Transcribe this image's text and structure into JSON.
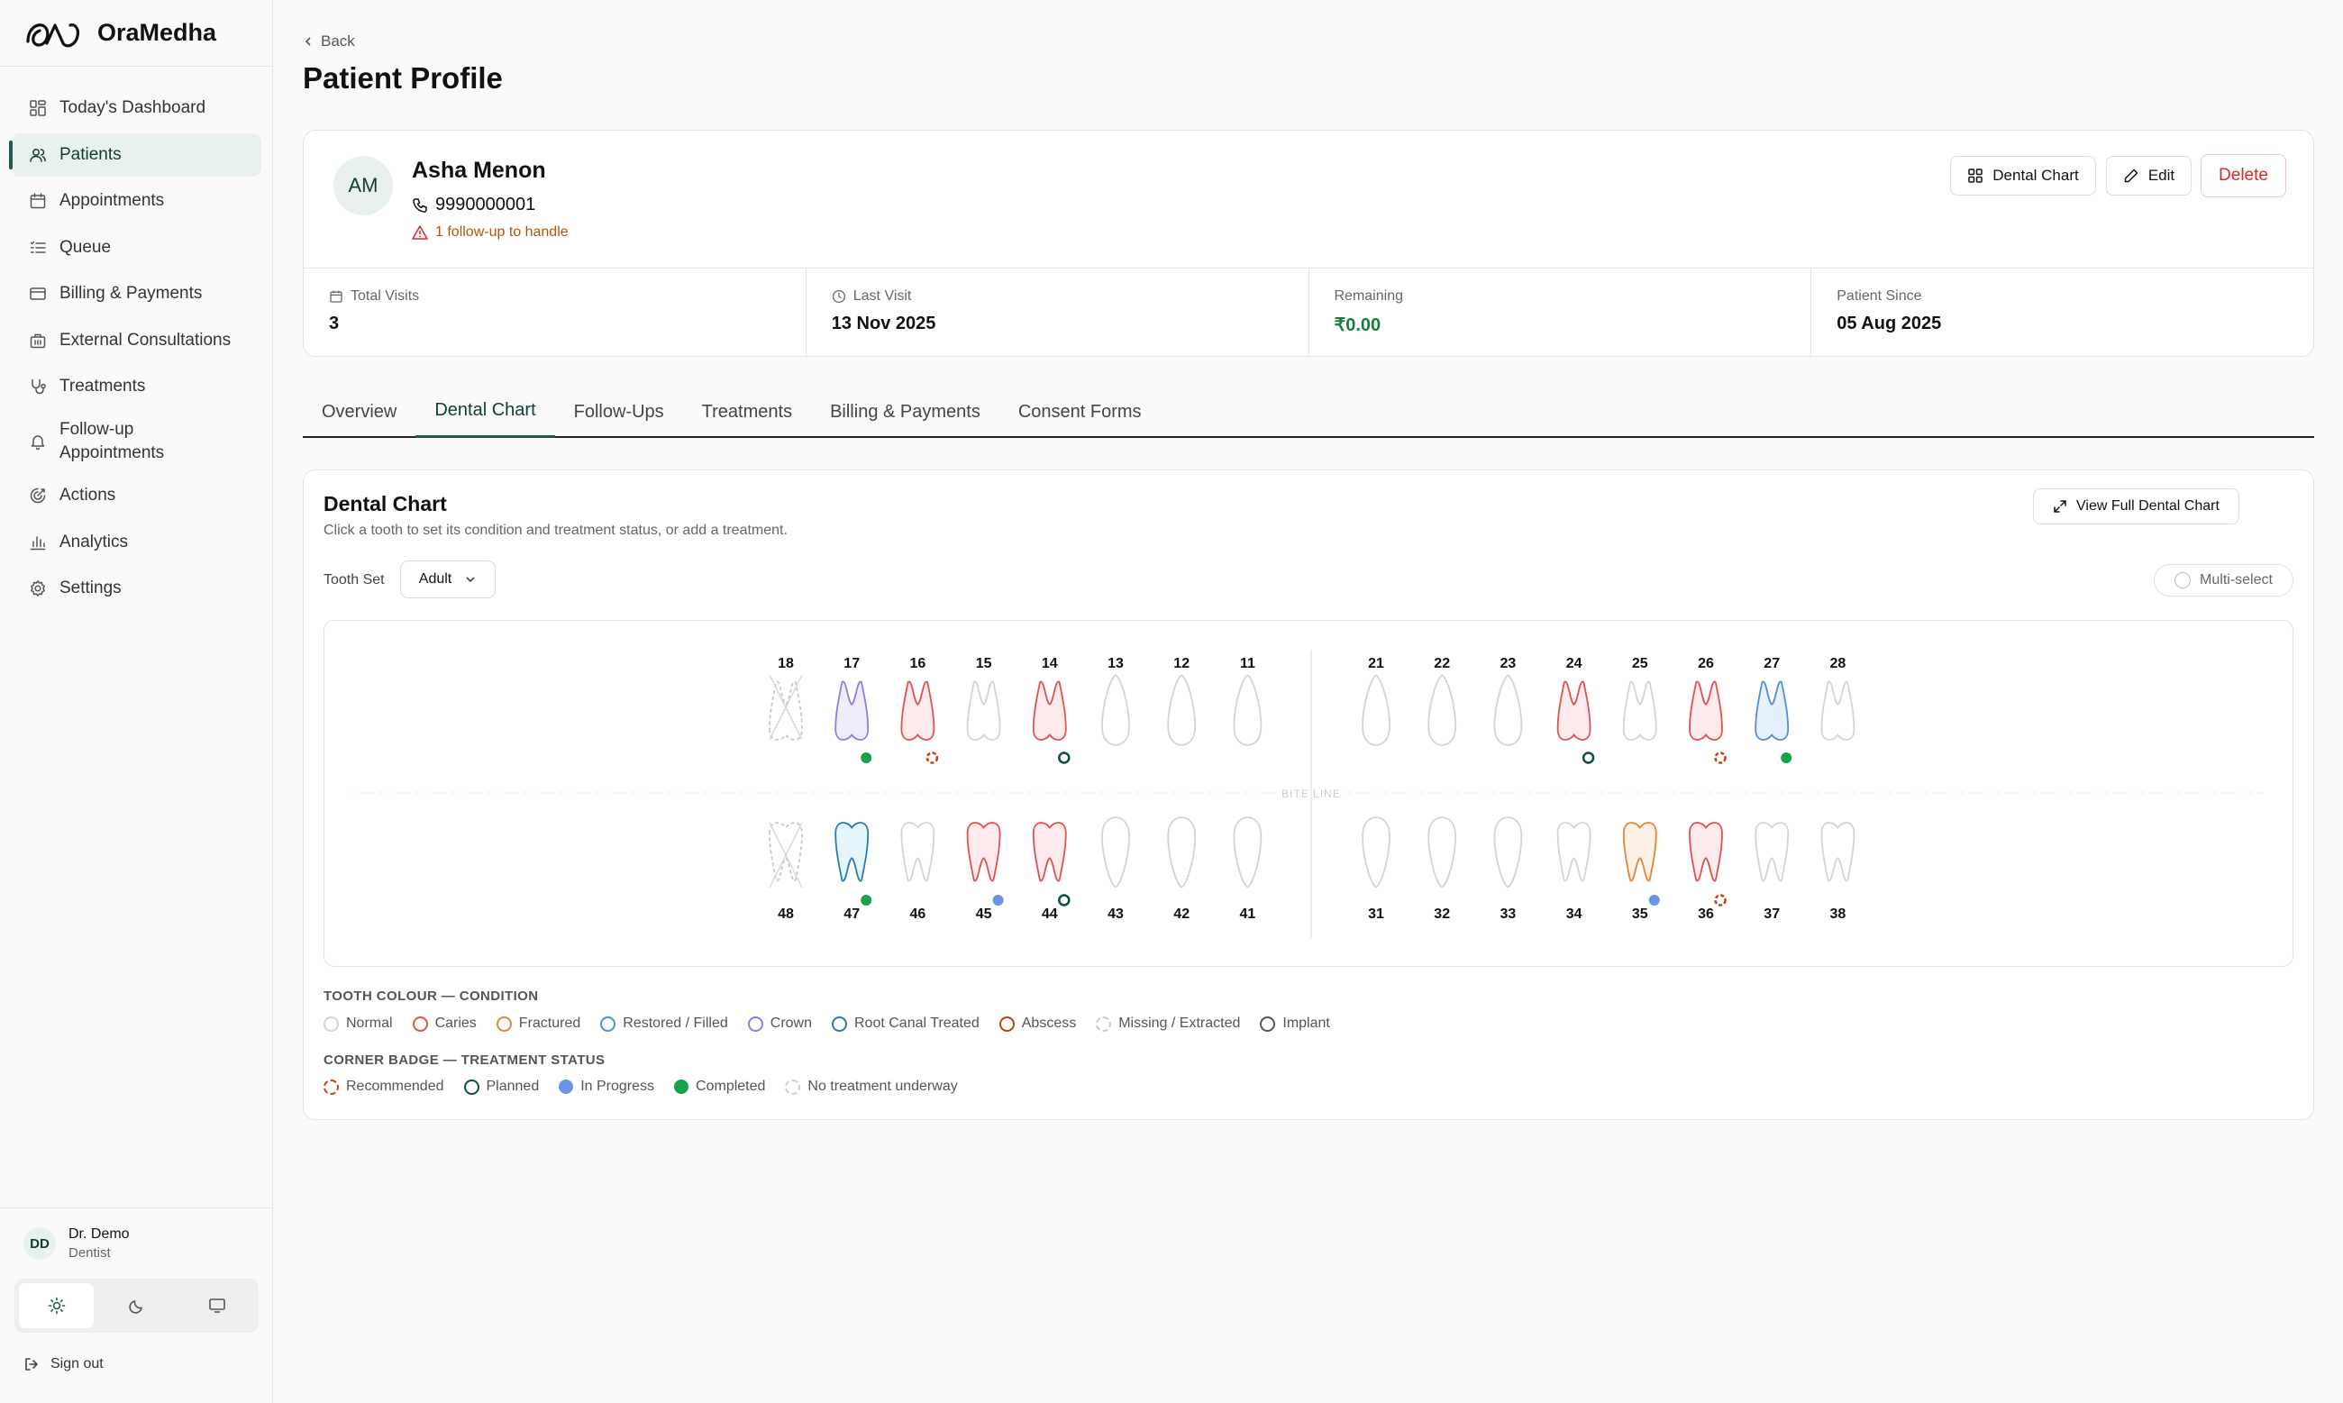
{
  "app": {
    "name": "OraMedha"
  },
  "nav": [
    {
      "id": "dashboard",
      "label": "Today's Dashboard",
      "icon": "dashboard-icon",
      "active": false
    },
    {
      "id": "patients",
      "label": "Patients",
      "icon": "users-icon",
      "active": true
    },
    {
      "id": "appointments",
      "label": "Appointments",
      "icon": "calendar-icon",
      "active": false
    },
    {
      "id": "queue",
      "label": "Queue",
      "icon": "list-icon",
      "active": false
    },
    {
      "id": "billing",
      "label": "Billing & Payments",
      "icon": "credit-card-icon",
      "active": false
    },
    {
      "id": "external",
      "label": "External Consultations",
      "icon": "building-icon",
      "active": false
    },
    {
      "id": "treatments",
      "label": "Treatments",
      "icon": "stethoscope-icon",
      "active": false
    },
    {
      "id": "followup",
      "label": "Follow-up Appointments",
      "icon": "bell-icon",
      "active": false
    },
    {
      "id": "actions",
      "label": "Actions",
      "icon": "actions-icon",
      "active": false
    },
    {
      "id": "analytics",
      "label": "Analytics",
      "icon": "bar-chart-icon",
      "active": false
    },
    {
      "id": "settings",
      "label": "Settings",
      "icon": "gear-icon",
      "active": false
    }
  ],
  "user": {
    "initials": "DD",
    "name": "Dr. Demo",
    "role": "Dentist"
  },
  "sidebar_footer": {
    "signout_label": "Sign out"
  },
  "header": {
    "back_label": "Back",
    "title": "Patient Profile"
  },
  "patient": {
    "initials": "AM",
    "name": "Asha Menon",
    "phone": "9990000001",
    "followup_warning": "1 follow-up to handle",
    "actions": {
      "dental_chart_label": "Dental Chart",
      "edit_label": "Edit",
      "delete_label": "Delete"
    },
    "stats": [
      {
        "label": "Total Visits",
        "value": "3",
        "icon": "calendar-icon"
      },
      {
        "label": "Last Visit",
        "value": "13 Nov 2025",
        "icon": "clock-icon"
      },
      {
        "label": "Remaining",
        "value": "₹0.00",
        "icon": ""
      },
      {
        "label": "Patient Since",
        "value": "05 Aug 2025",
        "icon": ""
      }
    ]
  },
  "tabs": [
    {
      "label": "Overview",
      "active": false
    },
    {
      "label": "Dental Chart",
      "active": true
    },
    {
      "label": "Follow-Ups",
      "active": false
    },
    {
      "label": "Treatments",
      "active": false
    },
    {
      "label": "Billing & Payments",
      "active": false
    },
    {
      "label": "Consent Forms",
      "active": false
    }
  ],
  "dental_chart": {
    "title": "Dental Chart",
    "subtitle": "Click a tooth to set its condition and treatment status, or add a treatment.",
    "view_full_label": "View Full Dental Chart",
    "tooth_set_label": "Tooth Set",
    "tooth_set_value": "Adult",
    "multi_select_label": "Multi-select",
    "bite_line_label": "BITE LINE",
    "upper": [
      {
        "n": "18",
        "condition": "missing",
        "status": "none"
      },
      {
        "n": "17",
        "condition": "crown",
        "status": "completed"
      },
      {
        "n": "16",
        "condition": "caries",
        "status": "recommended"
      },
      {
        "n": "15",
        "condition": "normal",
        "status": "none"
      },
      {
        "n": "14",
        "condition": "caries",
        "status": "planned"
      },
      {
        "n": "13",
        "condition": "normal",
        "status": "none"
      },
      {
        "n": "12",
        "condition": "normal",
        "status": "none"
      },
      {
        "n": "11",
        "condition": "normal",
        "status": "none"
      },
      {
        "n": "21",
        "condition": "normal",
        "status": "none"
      },
      {
        "n": "22",
        "condition": "normal",
        "status": "none"
      },
      {
        "n": "23",
        "condition": "normal",
        "status": "none"
      },
      {
        "n": "24",
        "condition": "caries",
        "status": "planned"
      },
      {
        "n": "25",
        "condition": "normal",
        "status": "none"
      },
      {
        "n": "26",
        "condition": "caries",
        "status": "recommended"
      },
      {
        "n": "27",
        "condition": "restored",
        "status": "completed"
      },
      {
        "n": "28",
        "condition": "normal",
        "status": "none"
      }
    ],
    "lower": [
      {
        "n": "48",
        "condition": "missing",
        "status": "none"
      },
      {
        "n": "47",
        "condition": "rct",
        "status": "completed"
      },
      {
        "n": "46",
        "condition": "normal",
        "status": "none"
      },
      {
        "n": "45",
        "condition": "caries",
        "status": "inprogress"
      },
      {
        "n": "44",
        "condition": "caries",
        "status": "planned"
      },
      {
        "n": "43",
        "condition": "normal",
        "status": "none"
      },
      {
        "n": "42",
        "condition": "normal",
        "status": "none"
      },
      {
        "n": "41",
        "condition": "normal",
        "status": "none"
      },
      {
        "n": "31",
        "condition": "normal",
        "status": "none"
      },
      {
        "n": "32",
        "condition": "normal",
        "status": "none"
      },
      {
        "n": "33",
        "condition": "normal",
        "status": "none"
      },
      {
        "n": "34",
        "condition": "normal",
        "status": "none"
      },
      {
        "n": "35",
        "condition": "fractured",
        "status": "inprogress"
      },
      {
        "n": "36",
        "condition": "caries",
        "status": "recommended"
      },
      {
        "n": "37",
        "condition": "normal",
        "status": "none"
      },
      {
        "n": "38",
        "condition": "normal",
        "status": "none"
      }
    ],
    "condition_legend_title": "TOOTH COLOUR — CONDITION",
    "condition_legend": [
      {
        "key": "normal",
        "label": "Normal"
      },
      {
        "key": "caries",
        "label": "Caries"
      },
      {
        "key": "fractured",
        "label": "Fractured"
      },
      {
        "key": "restored",
        "label": "Restored / Filled"
      },
      {
        "key": "crown",
        "label": "Crown"
      },
      {
        "key": "rct",
        "label": "Root Canal Treated"
      },
      {
        "key": "abscess",
        "label": "Abscess"
      },
      {
        "key": "missing",
        "label": "Missing / Extracted"
      },
      {
        "key": "implant",
        "label": "Implant"
      }
    ],
    "status_legend_title": "CORNER BADGE — TREATMENT STATUS",
    "status_legend": [
      {
        "key": "recommended",
        "label": "Recommended"
      },
      {
        "key": "planned",
        "label": "Planned"
      },
      {
        "key": "inprogress",
        "label": "In Progress"
      },
      {
        "key": "completed",
        "label": "Completed"
      },
      {
        "key": "none",
        "label": "No treatment underway"
      }
    ]
  },
  "colors": {
    "accent": "#1f5a52",
    "normal": {
      "stroke": "#d4d4d4",
      "fill": "#ffffff"
    },
    "caries": {
      "stroke": "#e05252",
      "fill": "#fdeaea"
    },
    "fractured": {
      "stroke": "#e0853a",
      "fill": "#fdf0e4"
    },
    "restored": {
      "stroke": "#4f8fd8",
      "fill": "#e7f1fc"
    },
    "crown": {
      "stroke": "#8b7fe0",
      "fill": "#efedfc"
    },
    "rct": {
      "stroke": "#2a7ab8",
      "fill": "#e4f5fb"
    },
    "abscess": {
      "stroke": "#c2410c",
      "fill": "#fbeee7"
    },
    "missing": {
      "stroke": "#c8c8c8",
      "fill": "#ffffff"
    },
    "implant": {
      "stroke": "#555555",
      "fill": "#f3f3f3"
    },
    "status": {
      "recommended": "#c2410c",
      "planned": "#0f4d45",
      "inprogress": "#6b93e3",
      "completed": "#16a34a",
      "none": "#cfcfcf"
    }
  }
}
